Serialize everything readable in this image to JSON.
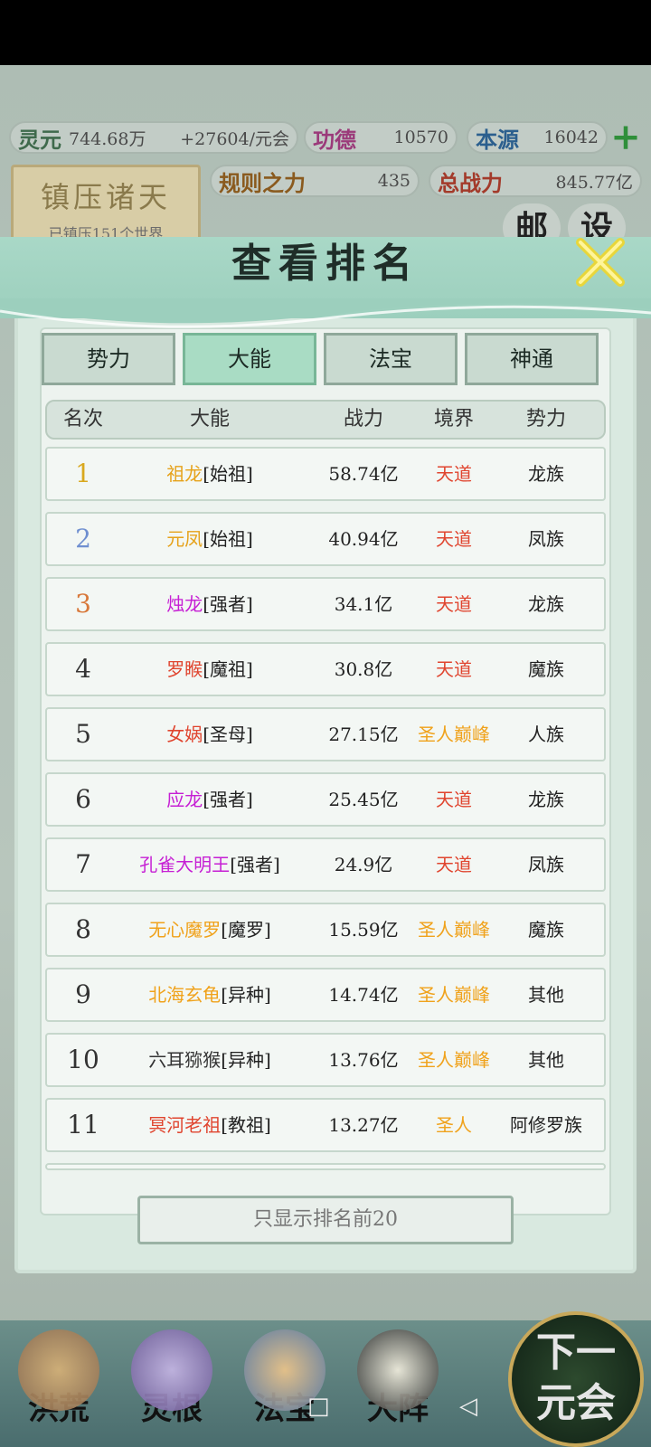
{
  "top": {
    "lingyuan_label": "灵元",
    "lingyuan_value": "744.68万",
    "lingyuan_rate": "+27604/元会",
    "gongde_label": "功德",
    "gongde_value": "10570",
    "benyuan_label": "本源",
    "benyuan_value": "16042",
    "guize_label": "规则之力",
    "guize_value": "435",
    "zongzhanli_label": "总战力",
    "zongzhanli_value": "845.77亿",
    "zhenya_title": "镇压诸天",
    "zhenya_sub": "已镇压151个世界",
    "mail_label": "邮",
    "settings_label": "设"
  },
  "modal": {
    "title": "查看排名",
    "tabs": [
      "势力",
      "大能",
      "法宝",
      "神通"
    ],
    "active_tab": "大能",
    "columns": [
      "名次",
      "大能",
      "战力",
      "境界",
      "势力"
    ],
    "rows": [
      {
        "rank": "1",
        "name": "祖龙",
        "title": "[始祖]",
        "power": "58.74亿",
        "realm": "天道",
        "faction": "龙族",
        "name_color": "#e6a21a",
        "realm_color": "#e0452f"
      },
      {
        "rank": "2",
        "name": "元凤",
        "title": "[始祖]",
        "power": "40.94亿",
        "realm": "天道",
        "faction": "凤族",
        "name_color": "#e6a21a",
        "realm_color": "#e0452f"
      },
      {
        "rank": "3",
        "name": "烛龙",
        "title": "[强者]",
        "power": "34.1亿",
        "realm": "天道",
        "faction": "龙族",
        "name_color": "#c61fd4",
        "realm_color": "#e0452f"
      },
      {
        "rank": "4",
        "name": "罗睺",
        "title": "[魔祖]",
        "power": "30.8亿",
        "realm": "天道",
        "faction": "魔族",
        "name_color": "#e0452f",
        "realm_color": "#e0452f"
      },
      {
        "rank": "5",
        "name": "女娲",
        "title": "[圣母]",
        "power": "27.15亿",
        "realm": "圣人巅峰",
        "faction": "人族",
        "name_color": "#e0452f",
        "realm_color": "#f0a21b"
      },
      {
        "rank": "6",
        "name": "应龙",
        "title": "[强者]",
        "power": "25.45亿",
        "realm": "天道",
        "faction": "龙族",
        "name_color": "#c61fd4",
        "realm_color": "#e0452f"
      },
      {
        "rank": "7",
        "name": "孔雀大明王",
        "title": "[强者]",
        "power": "24.9亿",
        "realm": "天道",
        "faction": "凤族",
        "name_color": "#c61fd4",
        "realm_color": "#e0452f"
      },
      {
        "rank": "8",
        "name": "无心魔罗",
        "title": "[魔罗]",
        "power": "15.59亿",
        "realm": "圣人巅峰",
        "faction": "魔族",
        "name_color": "#f0a21b",
        "realm_color": "#f0a21b"
      },
      {
        "rank": "9",
        "name": "北海玄龟",
        "title": "[异种]",
        "power": "14.74亿",
        "realm": "圣人巅峰",
        "faction": "其他",
        "name_color": "#f0a21b",
        "realm_color": "#f0a21b"
      },
      {
        "rank": "10",
        "name": "六耳猕猴",
        "title": "[异种]",
        "power": "13.76亿",
        "realm": "圣人巅峰",
        "faction": "其他",
        "name_color": "#333333",
        "realm_color": "#f0a21b"
      },
      {
        "rank": "11",
        "name": "冥河老祖",
        "title": "[教祖]",
        "power": "13.27亿",
        "realm": "圣人",
        "faction": "阿修罗族",
        "name_color": "#e0452f",
        "realm_color": "#f0a21b"
      }
    ],
    "filter_button": "只显示排名前20"
  },
  "bottom_nav": {
    "items": [
      "洪荒",
      "灵根",
      "法宝",
      "大阵"
    ],
    "next_button_line1": "下一",
    "next_button_line2": "元会",
    "sys_home": "□",
    "sys_back": "◁"
  }
}
